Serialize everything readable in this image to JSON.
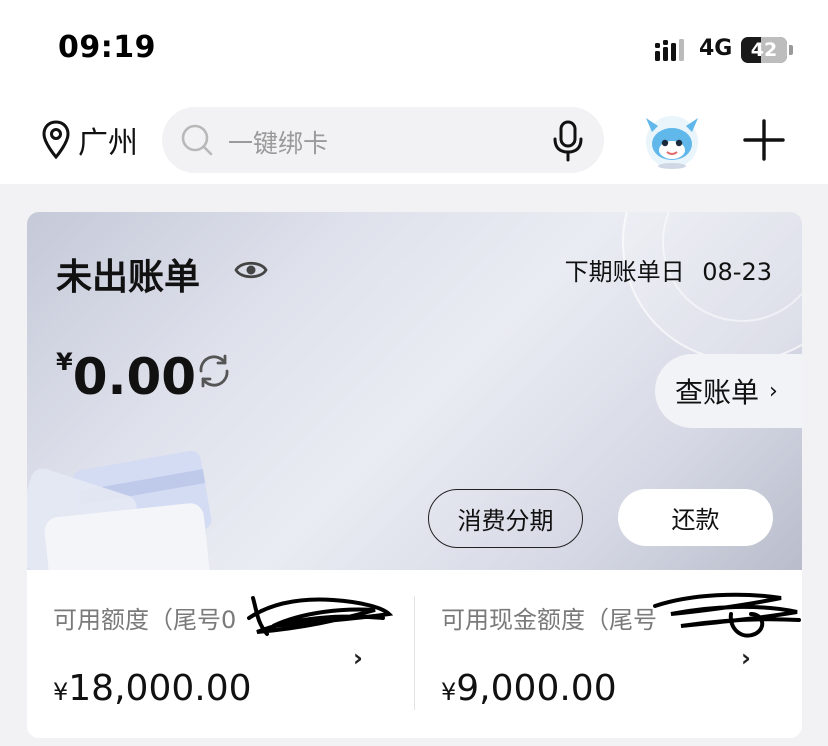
{
  "status_bar": {
    "time": "09:19",
    "network": "4G",
    "battery": "42"
  },
  "header": {
    "location": "广州",
    "search_placeholder": "一键绑卡"
  },
  "bill_card": {
    "title": "未出账单",
    "next_bill_date_label": "下期账单日",
    "next_bill_date": "08-23",
    "currency": "¥",
    "amount": "0.00",
    "view_bill": "查账单",
    "installment_button": "消费分期",
    "repay_button": "还款"
  },
  "limits": {
    "available_label": "可用额度（尾号0",
    "available_currency": "¥",
    "available_amount": "18,000.00",
    "cash_label": "可用现金额度（尾号",
    "cash_currency": "¥",
    "cash_amount": "9,000.00"
  },
  "colors": {
    "background": "#f2f2f4",
    "card_surface": "#ffffff",
    "text": "#111111",
    "muted": "#7a7a7a"
  },
  "icons": [
    "location-pin-icon",
    "search-icon",
    "microphone-icon",
    "mascot-avatar",
    "plus-icon",
    "eye-icon",
    "refresh-icon",
    "chevron-right-icon"
  ]
}
